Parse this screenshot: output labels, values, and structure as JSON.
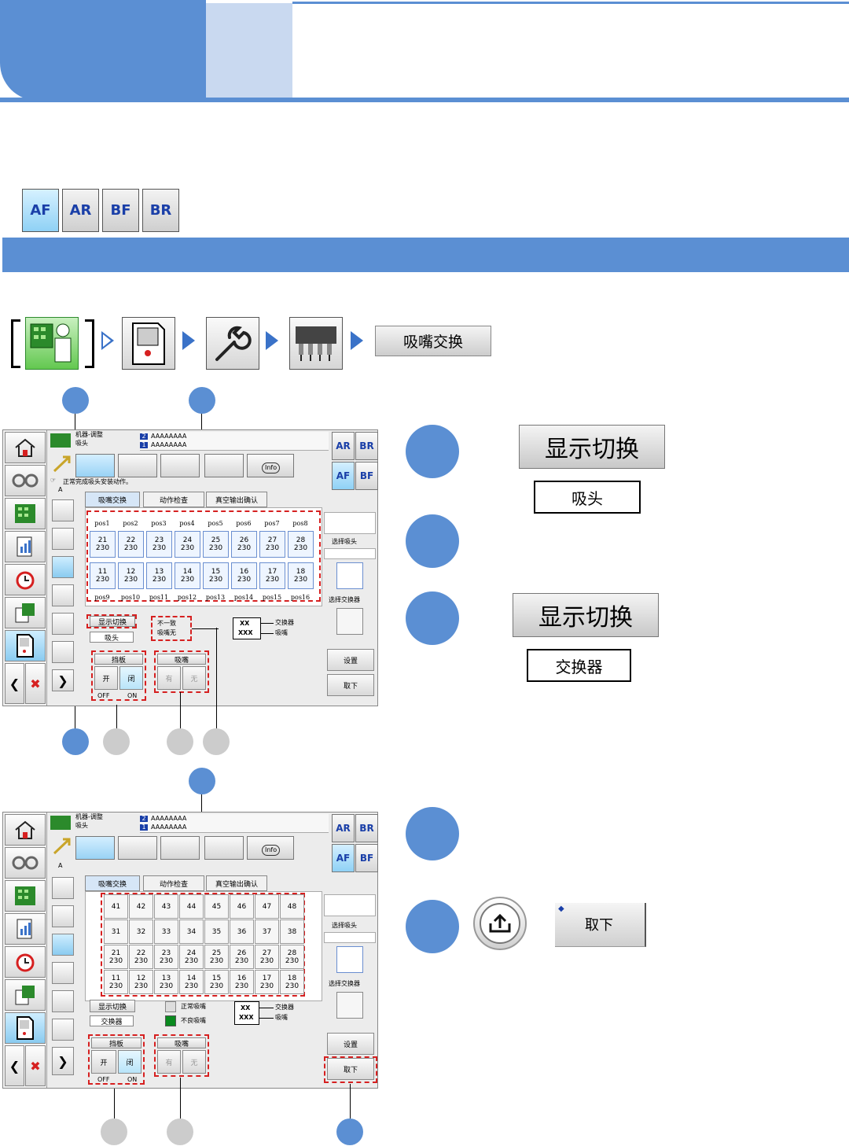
{
  "modules": [
    {
      "label": "AF",
      "active": true
    },
    {
      "label": "AR",
      "active": false
    },
    {
      "label": "BF",
      "active": false
    },
    {
      "label": "BR",
      "active": false
    }
  ],
  "nav": {
    "final_button": "吸嘴交换"
  },
  "screen1": {
    "title_line1": "机器-调整",
    "title_line2": "吸头",
    "machine_id_2": "AAAAAAAA",
    "machine_id_1": "AAAAAAAA",
    "info_label": "Info",
    "status_msg": "正常完成吸头安装动作。",
    "toolbar_letter": "A",
    "tabs": [
      "吸嘴交换",
      "动作检查",
      "真空输出确认"
    ],
    "top_pos_labels": [
      "pos1",
      "pos2",
      "pos3",
      "pos4",
      "pos5",
      "pos6",
      "pos7",
      "pos8"
    ],
    "bottom_pos_labels": [
      "pos9",
      "pos10",
      "pos11",
      "pos12",
      "pos13",
      "pos14",
      "pos15",
      "pos16"
    ],
    "row1": [
      [
        "21",
        "230"
      ],
      [
        "22",
        "230"
      ],
      [
        "23",
        "230"
      ],
      [
        "24",
        "230"
      ],
      [
        "25",
        "230"
      ],
      [
        "26",
        "230"
      ],
      [
        "27",
        "230"
      ],
      [
        "28",
        "230"
      ]
    ],
    "row2": [
      [
        "11",
        "230"
      ],
      [
        "12",
        "230"
      ],
      [
        "13",
        "230"
      ],
      [
        "14",
        "230"
      ],
      [
        "15",
        "230"
      ],
      [
        "16",
        "230"
      ],
      [
        "17",
        "230"
      ],
      [
        "18",
        "230"
      ]
    ],
    "select_head": "选择吸头",
    "select_changer": "选择交换器",
    "display_switch": "显示切换",
    "display_value": "吸头",
    "mismatch_line1": "不一致",
    "mismatch_line2": "吸嘴无",
    "legend_xx": "XX",
    "legend_xxx": "XXX",
    "legend_changer": "交换器",
    "legend_nozzle": "吸嘴",
    "shutter_label": "挡板",
    "open_label": "开",
    "close_label": "闭",
    "off_label": "OFF",
    "on_label": "ON",
    "nozzle_label": "吸嘴",
    "have_label": "有",
    "none_label": "无",
    "set_label": "设置",
    "remove_label": "取下",
    "mode_grid": [
      "AR",
      "BR",
      "AF",
      "BF"
    ]
  },
  "screen2": {
    "title_line1": "机器-调整",
    "title_line2": "吸头",
    "machine_id_2": "AAAAAAAA",
    "machine_id_1": "AAAAAAAA",
    "info_label": "Info",
    "toolbar_letter": "A",
    "tabs": [
      "吸嘴交换",
      "动作检查",
      "真空输出确认"
    ],
    "grid": [
      [
        [
          "41",
          ""
        ],
        [
          "42",
          ""
        ],
        [
          "43",
          ""
        ],
        [
          "44",
          ""
        ],
        [
          "45",
          ""
        ],
        [
          "46",
          ""
        ],
        [
          "47",
          ""
        ],
        [
          "48",
          ""
        ]
      ],
      [
        [
          "31",
          ""
        ],
        [
          "32",
          ""
        ],
        [
          "33",
          ""
        ],
        [
          "34",
          ""
        ],
        [
          "35",
          ""
        ],
        [
          "36",
          ""
        ],
        [
          "37",
          ""
        ],
        [
          "38",
          ""
        ]
      ],
      [
        [
          "21",
          "230"
        ],
        [
          "22",
          "230"
        ],
        [
          "23",
          "230"
        ],
        [
          "24",
          "230"
        ],
        [
          "25",
          "230"
        ],
        [
          "26",
          "230"
        ],
        [
          "27",
          "230"
        ],
        [
          "28",
          "230"
        ]
      ],
      [
        [
          "11",
          "230"
        ],
        [
          "12",
          "230"
        ],
        [
          "13",
          "230"
        ],
        [
          "14",
          "230"
        ],
        [
          "15",
          "230"
        ],
        [
          "16",
          "230"
        ],
        [
          "17",
          "230"
        ],
        [
          "18",
          "230"
        ]
      ]
    ],
    "select_head": "选择吸头",
    "select_changer": "选择交换器",
    "display_switch": "显示切换",
    "display_value": "交换器",
    "legend_normal": "正常吸嘴",
    "legend_bad": "不良吸嘴",
    "legend_xx": "XX",
    "legend_xxx": "XXX",
    "legend_changer": "交换器",
    "legend_nozzle": "吸嘴",
    "shutter_label": "挡板",
    "open_label": "开",
    "close_label": "闭",
    "off_label": "OFF",
    "on_label": "ON",
    "nozzle_label": "吸嘴",
    "have_label": "有",
    "none_label": "无",
    "set_label": "设置",
    "remove_label": "取下",
    "mode_grid": [
      "AR",
      "BR",
      "AF",
      "BF"
    ]
  },
  "instructions": {
    "btn1": "显示切换",
    "box1": "吸头",
    "btn2": "显示切换",
    "box2": "交换器",
    "remove_btn": "取下"
  },
  "colors": {
    "accent": "#5b8fd3",
    "accent_light": "#c9d9f0",
    "callout_gray": "#cccccc",
    "dash_red": "#d62020"
  }
}
